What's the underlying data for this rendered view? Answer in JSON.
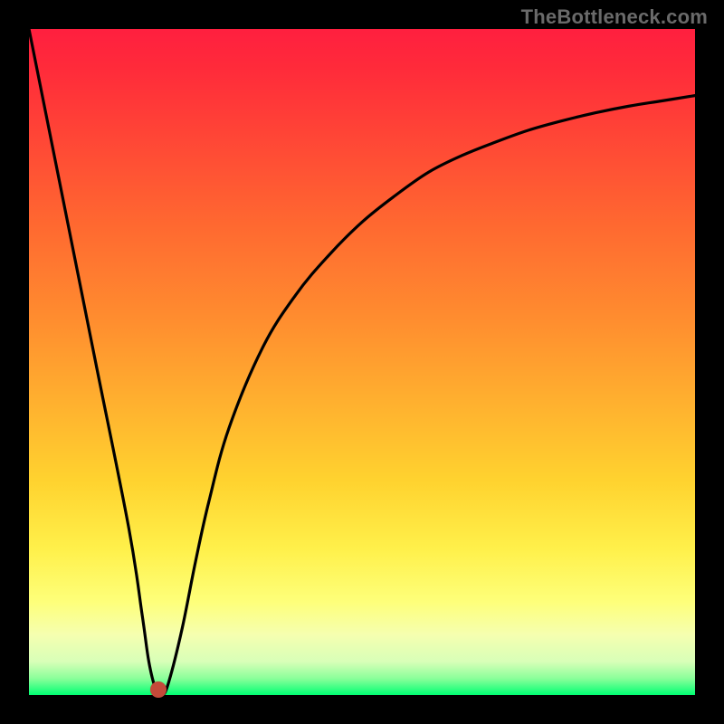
{
  "watermark": "TheBottleneck.com",
  "chart_data": {
    "type": "line",
    "title": "",
    "xlabel": "",
    "ylabel": "",
    "xlim": [
      0,
      100
    ],
    "ylim": [
      0,
      100
    ],
    "grid": false,
    "legend": false,
    "series": [
      {
        "name": "bottleneck-curve",
        "x": [
          0,
          5,
          10,
          15,
          17,
          18,
          19,
          20,
          21,
          23,
          25,
          27,
          30,
          35,
          40,
          45,
          50,
          55,
          60,
          65,
          70,
          75,
          80,
          85,
          90,
          95,
          100
        ],
        "values": [
          100,
          75,
          50,
          25,
          12,
          5,
          1,
          0,
          2,
          10,
          20,
          29,
          40,
          52,
          60,
          66,
          71,
          75,
          78.5,
          81,
          83,
          84.8,
          86.2,
          87.4,
          88.4,
          89.2,
          90
        ]
      }
    ],
    "marker": {
      "x": 19.4,
      "y": 0.8,
      "color": "#c44a3a"
    }
  },
  "colors": {
    "curve_stroke": "#000000",
    "background_border": "#000000",
    "marker": "#c44a3a"
  }
}
